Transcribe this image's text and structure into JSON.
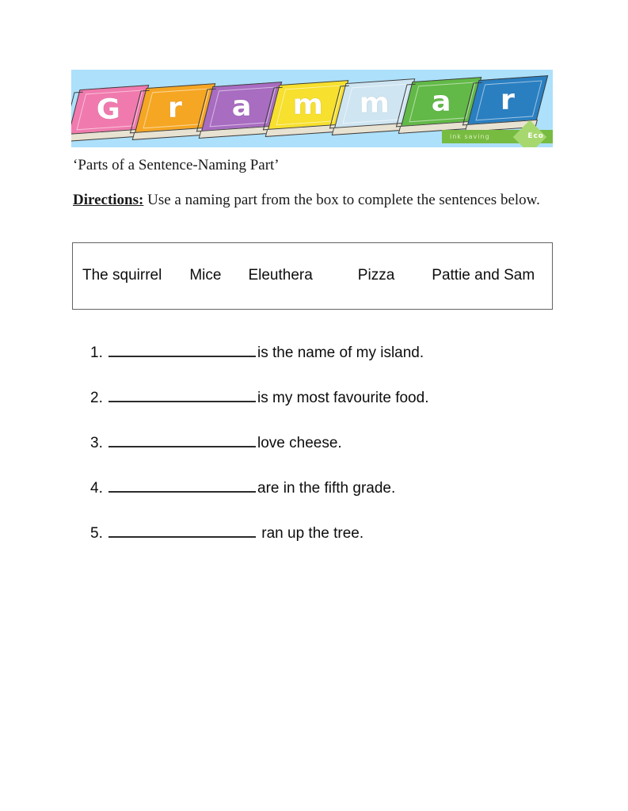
{
  "banner": {
    "background_color": "#ace0fb",
    "books": [
      {
        "letter": "G",
        "color": "#f07aae"
      },
      {
        "letter": "r",
        "color": "#f5a623"
      },
      {
        "letter": "a",
        "color": "#a86cc1"
      },
      {
        "letter": "m",
        "color": "#f7e02e"
      },
      {
        "letter": "m",
        "color": "#cfe5f2"
      },
      {
        "letter": "a",
        "color": "#62b947"
      },
      {
        "letter": "r",
        "color": "#2a7fc1"
      }
    ],
    "eco_badge": {
      "text": "ink saving",
      "word": "Eco",
      "color": "#77bb41"
    }
  },
  "worksheet": {
    "title": "‘Parts of a Sentence-Naming Part’",
    "directions_label": "Directions:",
    "directions_text": " Use a naming part from the  box to complete the sentences below."
  },
  "word_bank": {
    "words": [
      "The squirrel",
      "Mice",
      "Eleuthera",
      "Pizza",
      "Pattie and Sam"
    ]
  },
  "questions": [
    {
      "number": "1.",
      "blank": "________________",
      "tail": "is the name of my island."
    },
    {
      "number": "2.",
      "blank": "________________",
      "tail": "is my most favourite food."
    },
    {
      "number": "3.",
      "blank": "________________",
      "tail": "love cheese."
    },
    {
      "number": "4.",
      "blank": "________________",
      "tail": "are in the fifth grade."
    },
    {
      "number": "5.",
      "blank": "________________",
      "tail": " ran up the tree."
    }
  ]
}
